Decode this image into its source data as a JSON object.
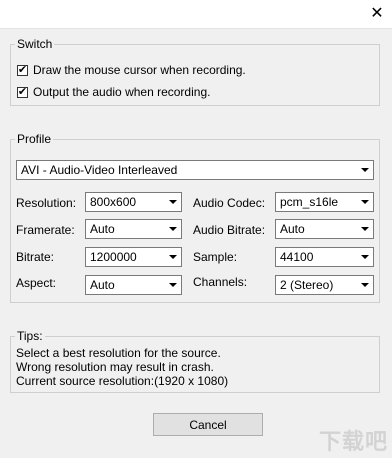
{
  "window": {
    "title": "",
    "close_glyph": "✕"
  },
  "switch": {
    "legend": "Switch",
    "options": [
      {
        "label": "Draw the mouse cursor when recording.",
        "checked": true
      },
      {
        "label": "Output the audio when recording.",
        "checked": true
      }
    ]
  },
  "profile": {
    "legend": "Profile",
    "format": "AVI - Audio-Video Interleaved",
    "resolution": {
      "label": "Resolution:",
      "value": "800x600"
    },
    "framerate": {
      "label": "Framerate:",
      "value": "Auto"
    },
    "bitrate": {
      "label": "Bitrate:",
      "value": "1200000"
    },
    "aspect": {
      "label": "Aspect:",
      "value": "Auto"
    },
    "audio_codec": {
      "label": "Audio Codec:",
      "value": "pcm_s16le"
    },
    "audio_bitrate": {
      "label": "Audio Bitrate:",
      "value": "Auto"
    },
    "sample": {
      "label": "Sample:",
      "value": "44100"
    },
    "channels": {
      "label": "Channels:",
      "value": "2 (Stereo)"
    }
  },
  "tips": {
    "legend": "Tips:",
    "lines": [
      "Select a best resolution for the source.",
      "Wrong resolution may result in crash.",
      "Current source resolution:(1920 x 1080)"
    ]
  },
  "buttons": {
    "cancel": "Cancel"
  },
  "watermark": "下载吧"
}
